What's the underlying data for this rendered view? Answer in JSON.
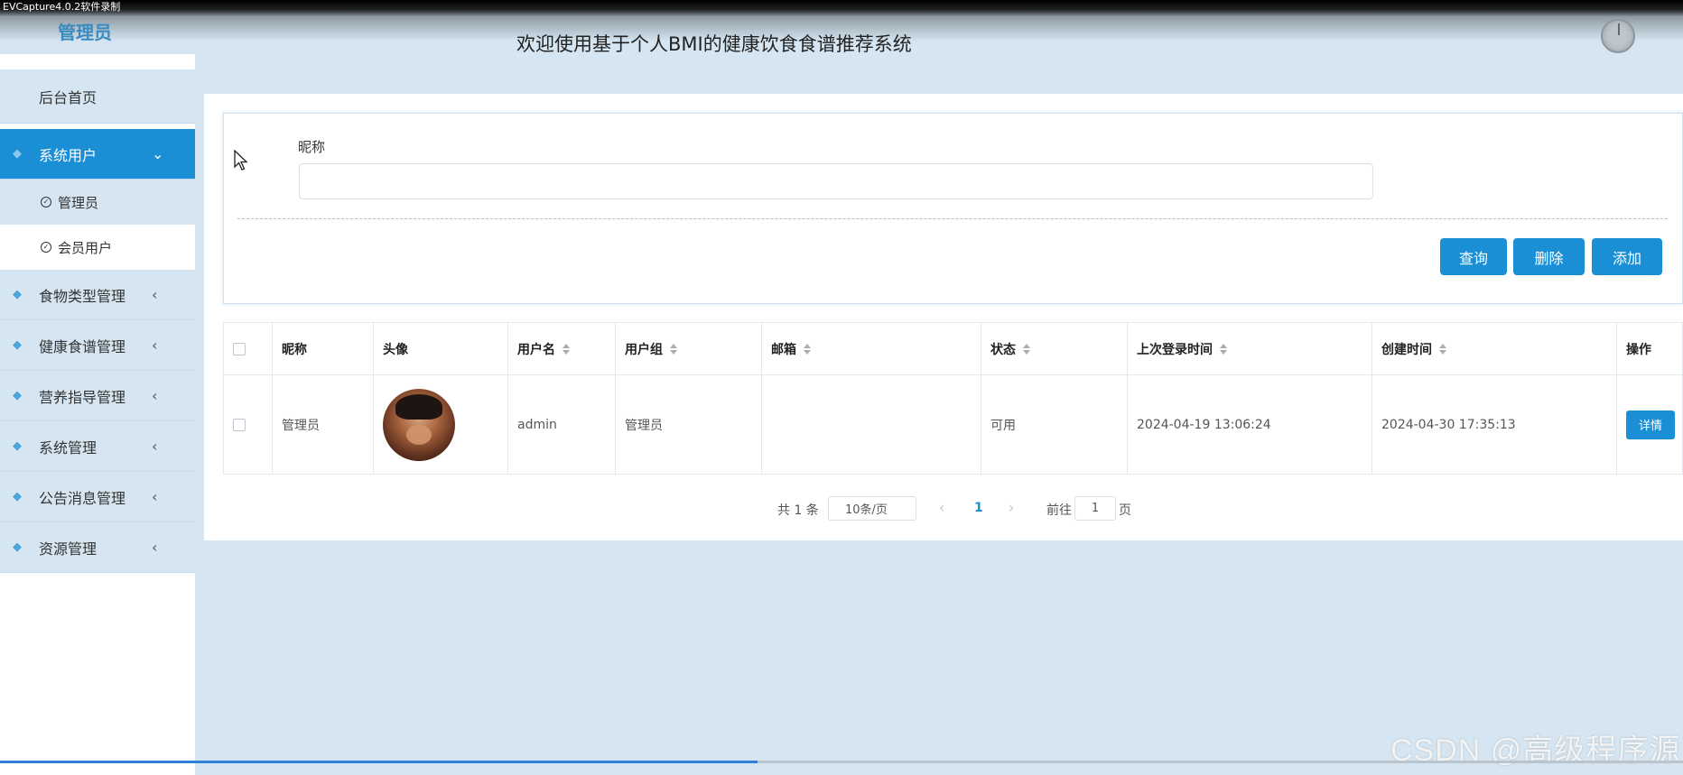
{
  "capture_banner": "EVCapture4.0.2软件录制",
  "header": {
    "admin_label": "管理员",
    "site_title": "欢迎使用基于个人BMI的健康饮食食谱推荐系统"
  },
  "sidebar": {
    "items": [
      {
        "label": "后台首页"
      },
      {
        "label": "系统用户",
        "active": true,
        "expanded": true,
        "children": [
          {
            "label": "管理员"
          },
          {
            "label": "会员用户"
          }
        ]
      },
      {
        "label": "食物类型管理"
      },
      {
        "label": "健康食谱管理"
      },
      {
        "label": "营养指导管理"
      },
      {
        "label": "系统管理"
      },
      {
        "label": "公告消息管理"
      },
      {
        "label": "资源管理"
      }
    ]
  },
  "search": {
    "field_label": "昵称",
    "field_value": "",
    "field_placeholder": "",
    "buttons": {
      "query": "查询",
      "delete": "删除",
      "add": "添加"
    }
  },
  "table": {
    "headers": [
      "昵称",
      "头像",
      "用户名",
      "用户组",
      "邮箱",
      "状态",
      "上次登录时间",
      "创建时间",
      "操作"
    ],
    "rows": [
      {
        "nickname": "管理员",
        "username": "admin",
        "group": "管理员",
        "email": "",
        "status": "可用",
        "last_login": "2024-04-19 13:06:24",
        "created": "2024-04-30 17:35:13",
        "action": "详情"
      }
    ]
  },
  "pagination": {
    "total": "共 1 条",
    "page_size": "10条/页",
    "current_page": "1",
    "goto_prefix": "前往",
    "goto_value": "1",
    "goto_suffix": "页"
  },
  "watermark": "CSDN @高级程序源",
  "video_progress": 0.45,
  "colors": {
    "accent": "#1b8fd6",
    "background": "#d5e6f2",
    "sidebar_active": "#1b8fd6"
  }
}
